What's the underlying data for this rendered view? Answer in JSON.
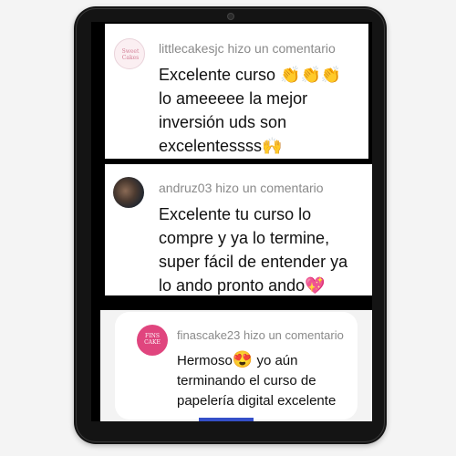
{
  "comments": [
    {
      "avatar_text": "Sweet Cakes",
      "header": "littlecakesjc hizo un comentario",
      "body_lines": [
        "Excelente curso",
        "lo ameeeee la mejor",
        "inversión uds son",
        "excelentessss"
      ],
      "emoji_line1": "👏👏👏",
      "emoji_line4": "🙌"
    },
    {
      "header": "andruz03 hizo un comentario",
      "body_lines": [
        "Excelente tu curso lo",
        "compre y ya lo termine,",
        "super fácil de entender ya",
        "lo ando pronto ando"
      ],
      "emoji_line4": "💖"
    },
    {
      "avatar_text": "FINS CAKE",
      "header": "finascake23 hizo un comentario",
      "body_lines": [
        "Hermoso",
        "yo aún",
        "terminando el curso de",
        "papelería digital excelente"
      ],
      "emoji_line1": "😍"
    }
  ]
}
